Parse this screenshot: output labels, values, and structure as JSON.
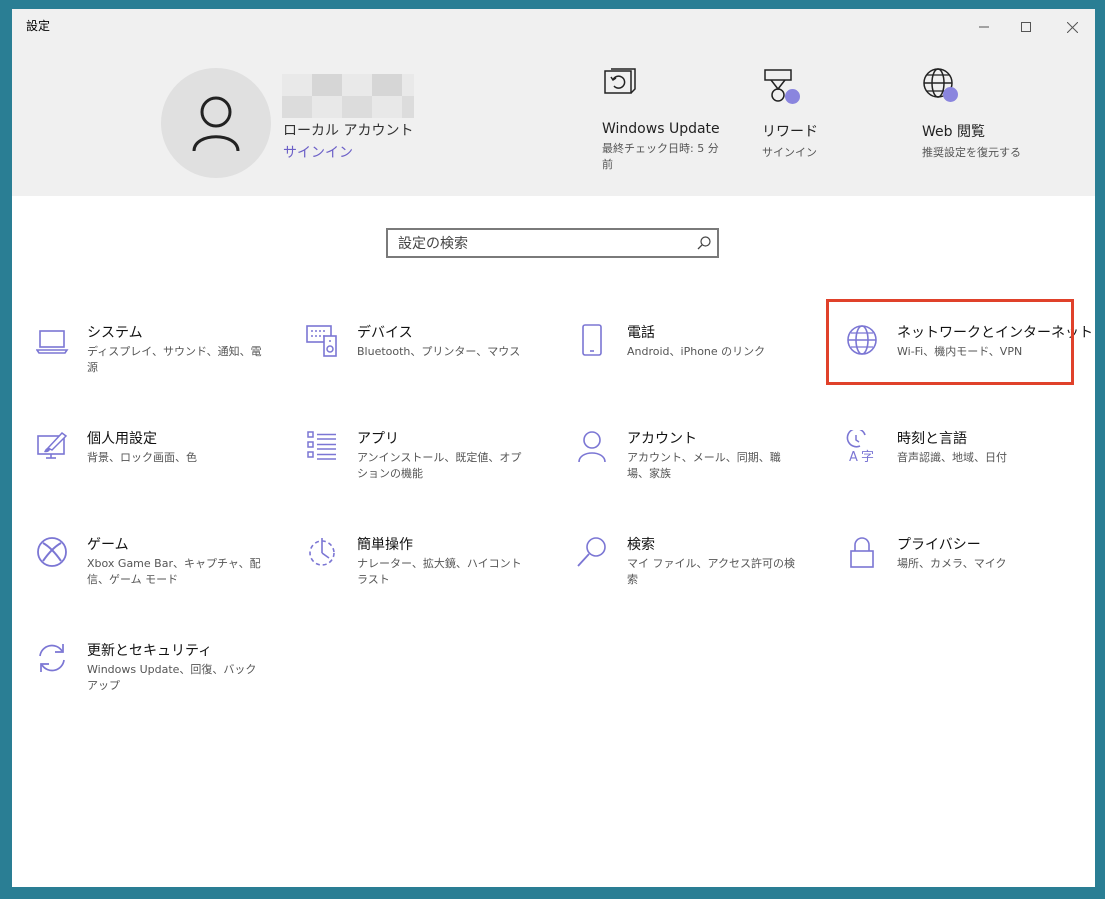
{
  "window": {
    "title": "設定"
  },
  "header": {
    "account_type": "ローカル アカウント",
    "signin": "サインイン",
    "quick": [
      {
        "title": "Windows Update",
        "sub": "最終チェック日時: 5 分前",
        "icon": "windows-update-icon"
      },
      {
        "title": "リワード",
        "sub": "サインイン",
        "icon": "rewards-icon"
      },
      {
        "title": "Web 閲覧",
        "sub": "推奨設定を復元する",
        "icon": "web-browsing-icon"
      }
    ]
  },
  "search": {
    "placeholder": "設定の検索"
  },
  "tiles": [
    {
      "title": "システム",
      "sub": "ディスプレイ、サウンド、通知、電源",
      "icon": "laptop-icon"
    },
    {
      "title": "デバイス",
      "sub": "Bluetooth、プリンター、マウス",
      "icon": "devices-icon"
    },
    {
      "title": "電話",
      "sub": "Android、iPhone のリンク",
      "icon": "phone-icon"
    },
    {
      "title": "ネットワークとインターネット",
      "sub": "Wi-Fi、機内モード、VPN",
      "icon": "globe-icon"
    },
    {
      "title": "個人用設定",
      "sub": "背景、ロック画面、色",
      "icon": "personalization-icon"
    },
    {
      "title": "アプリ",
      "sub": "アンインストール、既定値、オプションの機能",
      "icon": "apps-icon"
    },
    {
      "title": "アカウント",
      "sub": "アカウント、メール、同期、職場、家族",
      "icon": "account-icon"
    },
    {
      "title": "時刻と言語",
      "sub": "音声認識、地域、日付",
      "icon": "time-language-icon"
    },
    {
      "title": "ゲーム",
      "sub": "Xbox Game Bar、キャプチャ、配信、ゲーム モード",
      "icon": "xbox-icon"
    },
    {
      "title": "簡単操作",
      "sub": "ナレーター、拡大鏡、ハイコントラスト",
      "icon": "ease-of-access-icon"
    },
    {
      "title": "検索",
      "sub": "マイ ファイル、アクセス許可の検索",
      "icon": "search-icon"
    },
    {
      "title": "プライバシー",
      "sub": "場所、カメラ、マイク",
      "icon": "lock-icon"
    },
    {
      "title": "更新とセキュリティ",
      "sub": "Windows Update、回復、バックアップ",
      "icon": "update-security-icon"
    }
  ],
  "colors": {
    "accent": "#6b5fc7",
    "highlight": "#e0412a",
    "header_bg": "#f0f0f0"
  }
}
